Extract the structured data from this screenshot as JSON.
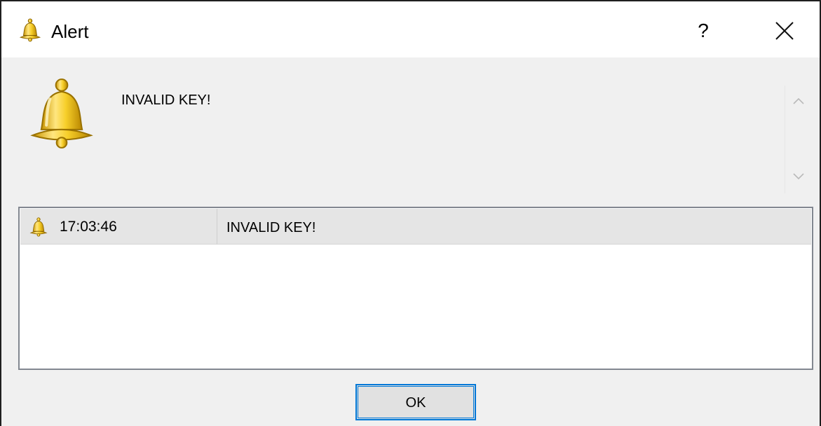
{
  "window": {
    "title": "Alert",
    "help_label": "?"
  },
  "icons": {
    "title": "bell-icon",
    "message": "bell-icon",
    "row": "bell-icon",
    "help": "question-mark-icon",
    "close": "close-icon",
    "scroll_up": "chevron-up-icon",
    "scroll_down": "chevron-down-icon"
  },
  "message": {
    "text": "INVALID KEY!"
  },
  "alerts": [
    {
      "time": "17:03:46",
      "message": "INVALID KEY!"
    }
  ],
  "buttons": {
    "ok_label": "OK"
  },
  "colors": {
    "accent": "#0078d7",
    "dialog_background": "#f0f0f0",
    "selected_row": "#e5e5e5",
    "bell_gold": "#f2c417"
  }
}
